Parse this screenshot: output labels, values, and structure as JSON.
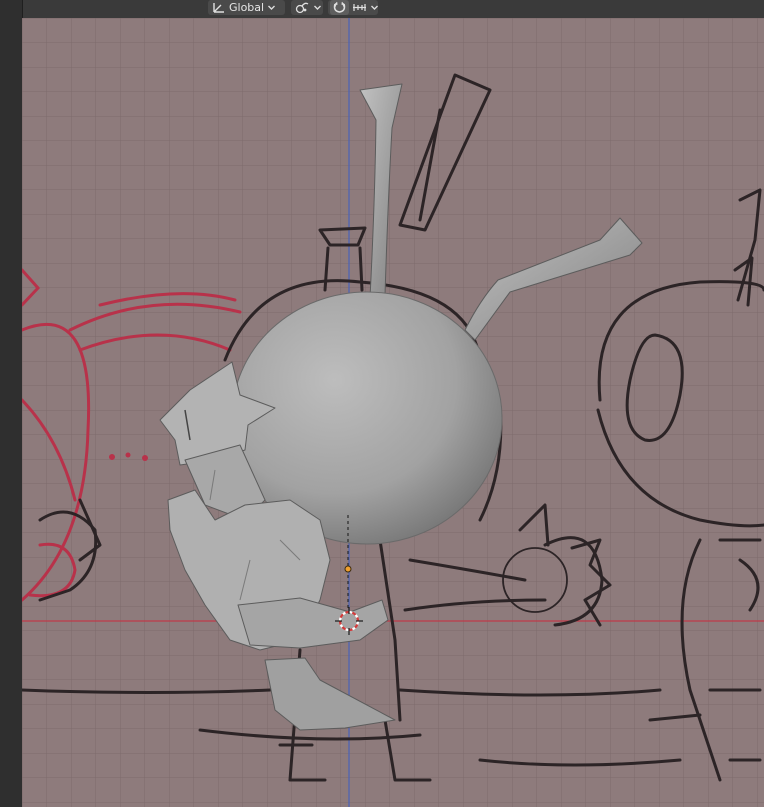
{
  "header": {
    "transform_orientation": {
      "label": "Global",
      "icon": "orientation-axes-icon",
      "caret_icon": "chevron-down-icon"
    },
    "pivot_point": {
      "icon": "pivot-point-icon",
      "caret_icon": "chevron-down-icon"
    },
    "snapping": {
      "toggle_icon": "magnet-icon",
      "target_icon": "snap-increment-icon",
      "caret_icon": "chevron-down-icon"
    }
  },
  "viewport": {
    "background_color": "#8e7b7c",
    "grid_color": "#7d6b6c",
    "x_axis_color": "#c03a48",
    "y_axis_color": "#4a62b8",
    "sketch_color_dark": "#2c2426",
    "sketch_color_red": "#b8324a",
    "model_color": "#a9a9a9",
    "objects": [
      "reference-sketch",
      "character-mesh",
      "3d-cursor",
      "object-origin"
    ]
  }
}
